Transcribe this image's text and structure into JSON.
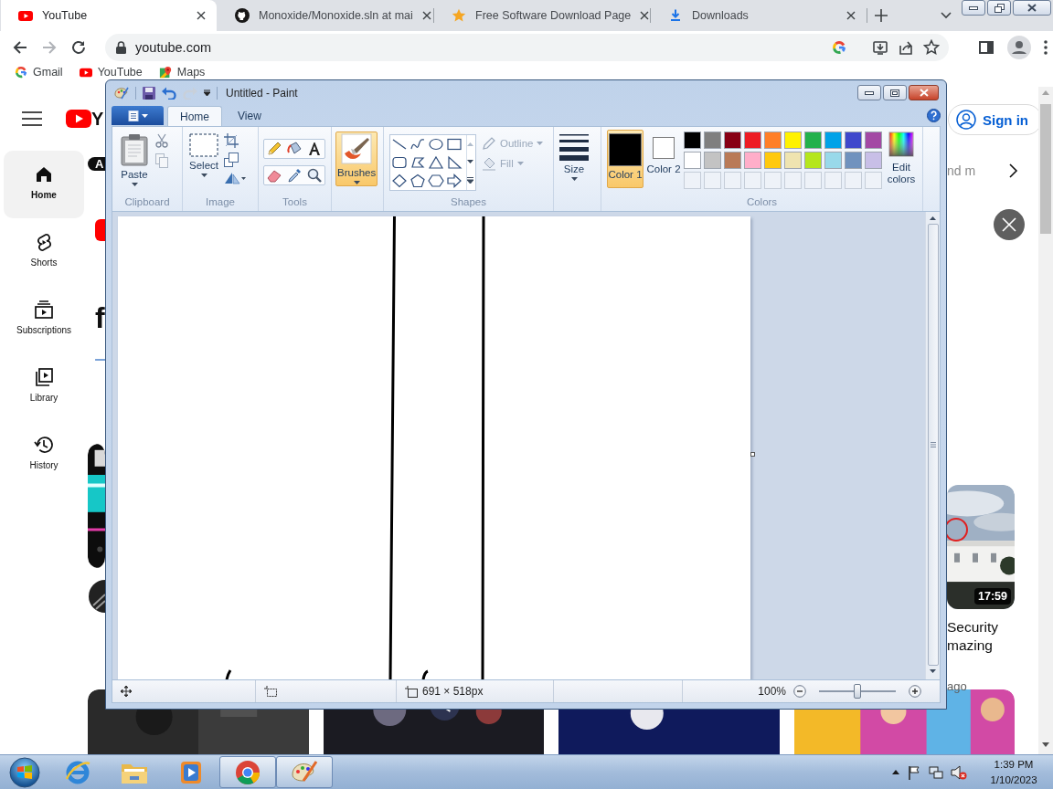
{
  "browser": {
    "tabs": [
      {
        "title": "YouTube",
        "kind": "youtube",
        "selected": true
      },
      {
        "title": "Monoxide/Monoxide.sln at mai",
        "kind": "github",
        "selected": false
      },
      {
        "title": "Free Software Download Page",
        "kind": "star",
        "selected": false
      },
      {
        "title": "Downloads",
        "kind": "download",
        "selected": false
      }
    ],
    "address": "youtube.com",
    "bookmarks": [
      {
        "label": "Gmail",
        "kind": "google"
      },
      {
        "label": "YouTube",
        "kind": "youtube"
      },
      {
        "label": "Maps",
        "kind": "maps"
      }
    ]
  },
  "youtube": {
    "logo_text": "Y",
    "sidebar": [
      {
        "label": "Home",
        "kind": "home",
        "selected": true
      },
      {
        "label": "Shorts",
        "kind": "shorts",
        "selected": false
      },
      {
        "label": "Subscriptions",
        "kind": "subscriptions",
        "selected": false
      },
      {
        "label": "Library",
        "kind": "library",
        "selected": false
      },
      {
        "label": "History",
        "kind": "history",
        "selected": false
      }
    ],
    "chip": "A",
    "heading": "f",
    "sign_in": "Sign in",
    "chip_end": "nd m",
    "video": {
      "duration": "17:59",
      "title_lines": [
        "Security",
        "mazing"
      ],
      "meta": "ago"
    }
  },
  "paint": {
    "title": "Untitled - Paint",
    "ribbon_tabs": [
      {
        "label": "Home",
        "selected": true
      },
      {
        "label": "View",
        "selected": false
      }
    ],
    "clipboard": {
      "label": "Clipboard",
      "paste": "Paste"
    },
    "image": {
      "label": "Image",
      "select": "Select"
    },
    "tools": {
      "label": "Tools"
    },
    "brushes": {
      "label": "Brushes",
      "selected": true
    },
    "shapes": {
      "label": "Shapes",
      "outline": {
        "label": "Outline",
        "disabled": true
      },
      "fill": {
        "label": "Fill",
        "disabled": true
      }
    },
    "size": {
      "label": "Size"
    },
    "colors": {
      "label": "Colors",
      "color1": {
        "label": "Color 1",
        "color": "#000000",
        "selected": true
      },
      "color2": {
        "label": "Color 2",
        "color": "#ffffff",
        "selected": false
      },
      "edit": "Edit colors"
    },
    "palette": [
      {
        "color": "#000000"
      },
      {
        "color": "#7f7f7f"
      },
      {
        "color": "#880015"
      },
      {
        "color": "#ed1c24"
      },
      {
        "color": "#ff7f27"
      },
      {
        "color": "#fff200"
      },
      {
        "color": "#22b14c"
      },
      {
        "color": "#00a2e8"
      },
      {
        "color": "#3f48cc"
      },
      {
        "color": "#a349a4"
      },
      {
        "color": "#ffffff"
      },
      {
        "color": "#c3c3c3"
      },
      {
        "color": "#b97a57"
      },
      {
        "color": "#ffaec9"
      },
      {
        "color": "#ffc90e"
      },
      {
        "color": "#efe4b0"
      },
      {
        "color": "#b5e61d"
      },
      {
        "color": "#99d9ea"
      },
      {
        "color": "#7092be"
      },
      {
        "color": "#c8bfe7"
      }
    ],
    "status": {
      "canvas_size": "691 × 518px",
      "zoom": "100%",
      "zoom_slider": {
        "level": 0.5
      }
    }
  },
  "taskbar": {
    "apps": [
      {
        "kind": "ie",
        "active": false
      },
      {
        "kind": "explorer",
        "active": false
      },
      {
        "kind": "media",
        "active": false
      },
      {
        "kind": "chrome",
        "active": true
      },
      {
        "kind": "paint",
        "active": true
      }
    ],
    "time": "1:39 PM",
    "date": "1/10/2023"
  }
}
